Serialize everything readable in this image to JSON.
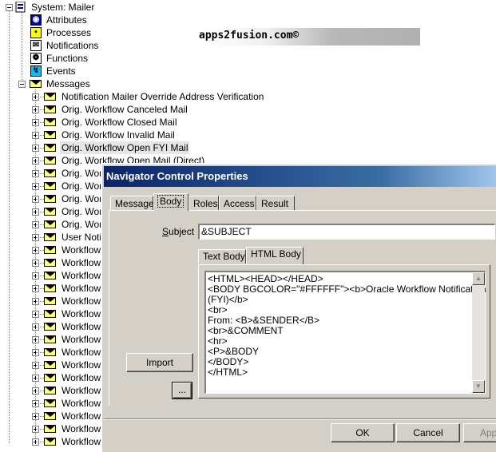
{
  "watermark": "apps2fusion.com©",
  "tree": {
    "root": "System: Mailer",
    "children": [
      "Attributes",
      "Processes",
      "Notifications",
      "Functions",
      "Events"
    ],
    "messages_label": "Messages",
    "messages": [
      "Notification Mailer Override Address Verification",
      "Orig. Workflow Canceled Mail",
      "Orig. Workflow Closed Mail",
      "Orig. Workflow Invalid Mail",
      "Orig. Workflow Open FYI Mail",
      "Orig. Workflow Open Mail (Direct)",
      "Orig. Work",
      "Orig. Work",
      "Orig. Work",
      "Orig. Work",
      "Orig. Work",
      "User Notif",
      "Workflow",
      "Workflow",
      "Workflow",
      "Workflow",
      "Workflow",
      "Workflow",
      "Workflow",
      "Workflow",
      "Workflow",
      "Workflow",
      "Workflow",
      "Workflow",
      "Workflow",
      "Workflow",
      "Workflow",
      "Workflow"
    ],
    "selected_index": 4
  },
  "dialog": {
    "title": "Navigator Control Properties",
    "tabs": [
      "Message",
      "Body",
      "Roles",
      "Access",
      "Result"
    ],
    "active_tab": "Body",
    "subject_label": "Subject",
    "subject_value": "&SUBJECT",
    "subtabs": [
      "Text Body",
      "HTML Body"
    ],
    "active_subtab": "HTML Body",
    "body_lines": [
      "<HTML><HEAD></HEAD>",
      "<BODY BGCOLOR=\"#FFFFFF\"><b>Oracle Workflow Notification",
      "(FYI)</b>",
      "<br>",
      "From: <B>&SENDER</B>",
      "<br>&COMMENT",
      "<hr>",
      "<P>&BODY",
      "</BODY>",
      "</HTML>"
    ],
    "import_button": "Import",
    "browse_button": "...",
    "ok_button": "OK",
    "cancel_button": "Cancel",
    "apply_button": "App"
  },
  "colors": {
    "titlebar_start": "#0a246a",
    "dialog_face": "#d4d0c8",
    "envelope": "#ffff80"
  },
  "icons": {
    "root": "mailer-item-type-icon",
    "attributes": "attributes-icon",
    "processes": "process-icon",
    "notifications": "notification-icon",
    "functions": "function-icon",
    "events": "event-icon",
    "message": "envelope-icon"
  }
}
